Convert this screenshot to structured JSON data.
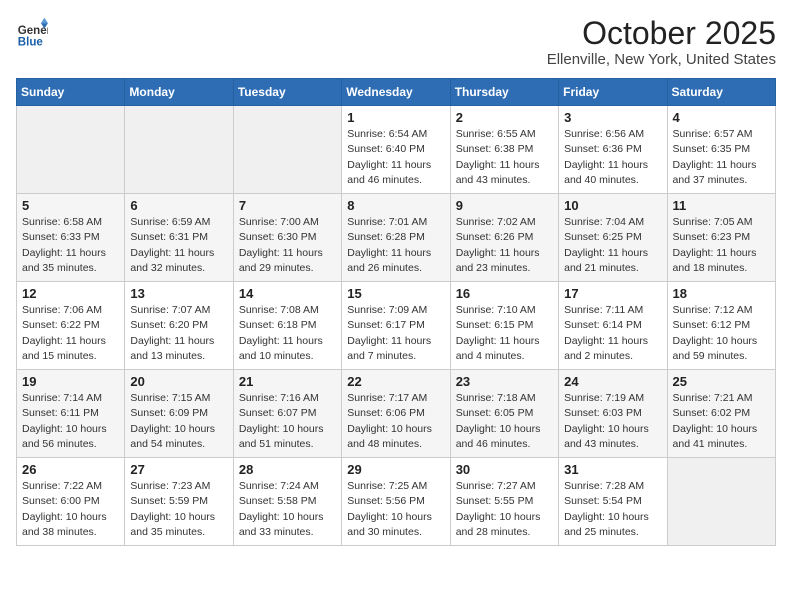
{
  "logo": {
    "general": "General",
    "blue": "Blue"
  },
  "header": {
    "title": "October 2025",
    "subtitle": "Ellenville, New York, United States"
  },
  "weekdays": [
    "Sunday",
    "Monday",
    "Tuesday",
    "Wednesday",
    "Thursday",
    "Friday",
    "Saturday"
  ],
  "weeks": [
    [
      {
        "day": "",
        "info": ""
      },
      {
        "day": "",
        "info": ""
      },
      {
        "day": "",
        "info": ""
      },
      {
        "day": "1",
        "info": "Sunrise: 6:54 AM\nSunset: 6:40 PM\nDaylight: 11 hours and 46 minutes."
      },
      {
        "day": "2",
        "info": "Sunrise: 6:55 AM\nSunset: 6:38 PM\nDaylight: 11 hours and 43 minutes."
      },
      {
        "day": "3",
        "info": "Sunrise: 6:56 AM\nSunset: 6:36 PM\nDaylight: 11 hours and 40 minutes."
      },
      {
        "day": "4",
        "info": "Sunrise: 6:57 AM\nSunset: 6:35 PM\nDaylight: 11 hours and 37 minutes."
      }
    ],
    [
      {
        "day": "5",
        "info": "Sunrise: 6:58 AM\nSunset: 6:33 PM\nDaylight: 11 hours and 35 minutes."
      },
      {
        "day": "6",
        "info": "Sunrise: 6:59 AM\nSunset: 6:31 PM\nDaylight: 11 hours and 32 minutes."
      },
      {
        "day": "7",
        "info": "Sunrise: 7:00 AM\nSunset: 6:30 PM\nDaylight: 11 hours and 29 minutes."
      },
      {
        "day": "8",
        "info": "Sunrise: 7:01 AM\nSunset: 6:28 PM\nDaylight: 11 hours and 26 minutes."
      },
      {
        "day": "9",
        "info": "Sunrise: 7:02 AM\nSunset: 6:26 PM\nDaylight: 11 hours and 23 minutes."
      },
      {
        "day": "10",
        "info": "Sunrise: 7:04 AM\nSunset: 6:25 PM\nDaylight: 11 hours and 21 minutes."
      },
      {
        "day": "11",
        "info": "Sunrise: 7:05 AM\nSunset: 6:23 PM\nDaylight: 11 hours and 18 minutes."
      }
    ],
    [
      {
        "day": "12",
        "info": "Sunrise: 7:06 AM\nSunset: 6:22 PM\nDaylight: 11 hours and 15 minutes."
      },
      {
        "day": "13",
        "info": "Sunrise: 7:07 AM\nSunset: 6:20 PM\nDaylight: 11 hours and 13 minutes."
      },
      {
        "day": "14",
        "info": "Sunrise: 7:08 AM\nSunset: 6:18 PM\nDaylight: 11 hours and 10 minutes."
      },
      {
        "day": "15",
        "info": "Sunrise: 7:09 AM\nSunset: 6:17 PM\nDaylight: 11 hours and 7 minutes."
      },
      {
        "day": "16",
        "info": "Sunrise: 7:10 AM\nSunset: 6:15 PM\nDaylight: 11 hours and 4 minutes."
      },
      {
        "day": "17",
        "info": "Sunrise: 7:11 AM\nSunset: 6:14 PM\nDaylight: 11 hours and 2 minutes."
      },
      {
        "day": "18",
        "info": "Sunrise: 7:12 AM\nSunset: 6:12 PM\nDaylight: 10 hours and 59 minutes."
      }
    ],
    [
      {
        "day": "19",
        "info": "Sunrise: 7:14 AM\nSunset: 6:11 PM\nDaylight: 10 hours and 56 minutes."
      },
      {
        "day": "20",
        "info": "Sunrise: 7:15 AM\nSunset: 6:09 PM\nDaylight: 10 hours and 54 minutes."
      },
      {
        "day": "21",
        "info": "Sunrise: 7:16 AM\nSunset: 6:07 PM\nDaylight: 10 hours and 51 minutes."
      },
      {
        "day": "22",
        "info": "Sunrise: 7:17 AM\nSunset: 6:06 PM\nDaylight: 10 hours and 48 minutes."
      },
      {
        "day": "23",
        "info": "Sunrise: 7:18 AM\nSunset: 6:05 PM\nDaylight: 10 hours and 46 minutes."
      },
      {
        "day": "24",
        "info": "Sunrise: 7:19 AM\nSunset: 6:03 PM\nDaylight: 10 hours and 43 minutes."
      },
      {
        "day": "25",
        "info": "Sunrise: 7:21 AM\nSunset: 6:02 PM\nDaylight: 10 hours and 41 minutes."
      }
    ],
    [
      {
        "day": "26",
        "info": "Sunrise: 7:22 AM\nSunset: 6:00 PM\nDaylight: 10 hours and 38 minutes."
      },
      {
        "day": "27",
        "info": "Sunrise: 7:23 AM\nSunset: 5:59 PM\nDaylight: 10 hours and 35 minutes."
      },
      {
        "day": "28",
        "info": "Sunrise: 7:24 AM\nSunset: 5:58 PM\nDaylight: 10 hours and 33 minutes."
      },
      {
        "day": "29",
        "info": "Sunrise: 7:25 AM\nSunset: 5:56 PM\nDaylight: 10 hours and 30 minutes."
      },
      {
        "day": "30",
        "info": "Sunrise: 7:27 AM\nSunset: 5:55 PM\nDaylight: 10 hours and 28 minutes."
      },
      {
        "day": "31",
        "info": "Sunrise: 7:28 AM\nSunset: 5:54 PM\nDaylight: 10 hours and 25 minutes."
      },
      {
        "day": "",
        "info": ""
      }
    ]
  ]
}
